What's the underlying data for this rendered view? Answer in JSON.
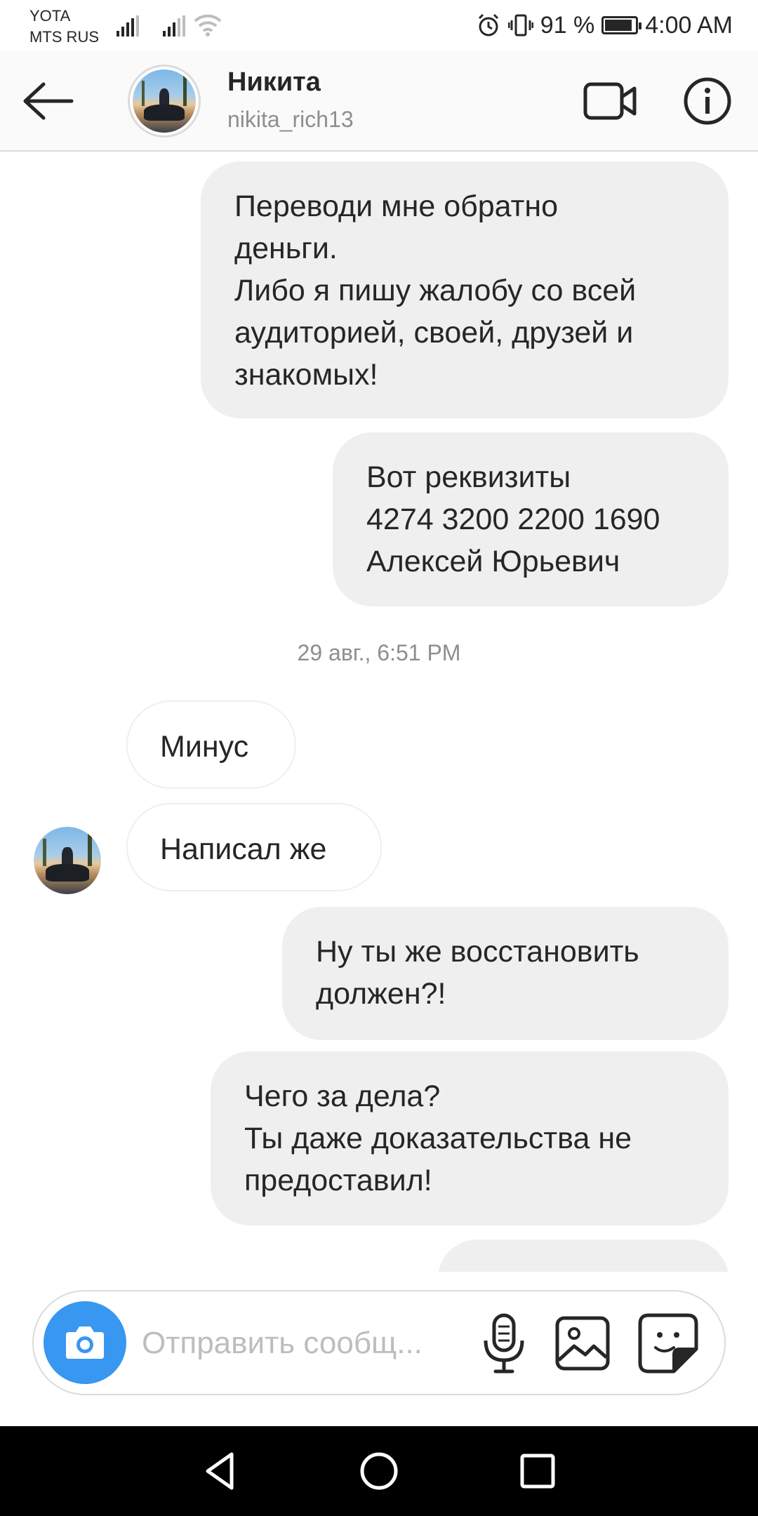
{
  "status_bar": {
    "carrier_1": "YOTA",
    "carrier_2": "MTS RUS",
    "battery_percent": "91 %",
    "battery_level": 0.91,
    "time": "4:00 AM",
    "icons": [
      "signal-icon",
      "wifi-icon",
      "alarm-icon",
      "vibrate-icon",
      "battery-icon"
    ]
  },
  "header": {
    "name": "Никита",
    "username": "nikita_rich13",
    "icons": [
      "back-arrow-icon",
      "avatar",
      "video-call-icon",
      "info-icon"
    ]
  },
  "messages": [
    {
      "direction": "outgoing",
      "text": "Переводи мне обратно\nденьги.\nЛибо я пишу жалобу со всей\nаудиторией, своей, друзей и\nзнакомых!"
    },
    {
      "direction": "outgoing",
      "text": "Вот реквизиты\n4274 3200 2200 1690\nАлексей Юрьевич"
    },
    {
      "direction": "timestamp",
      "text": "29 авг., 6:51 PM"
    },
    {
      "direction": "incoming",
      "text": "Минус"
    },
    {
      "direction": "incoming",
      "text": "Написал же"
    },
    {
      "direction": "outgoing",
      "text": "Ну ты же восстановить\nдолжен?!"
    },
    {
      "direction": "outgoing",
      "text": "Чего за дела?\nТы даже доказательства не\nпредоставил!"
    }
  ],
  "composer": {
    "placeholder": "Отправить сообщ...",
    "icons": [
      "camera-icon",
      "microphone-icon",
      "gallery-icon",
      "sticker-icon"
    ]
  },
  "nav_bar": {
    "icons": [
      "nav-back-icon",
      "nav-home-icon",
      "nav-recents-icon"
    ]
  },
  "colors": {
    "accent": "#3897f0",
    "bubble_outgoing": "#efefef",
    "text_primary": "#262626",
    "text_secondary": "#8e8e8e"
  }
}
